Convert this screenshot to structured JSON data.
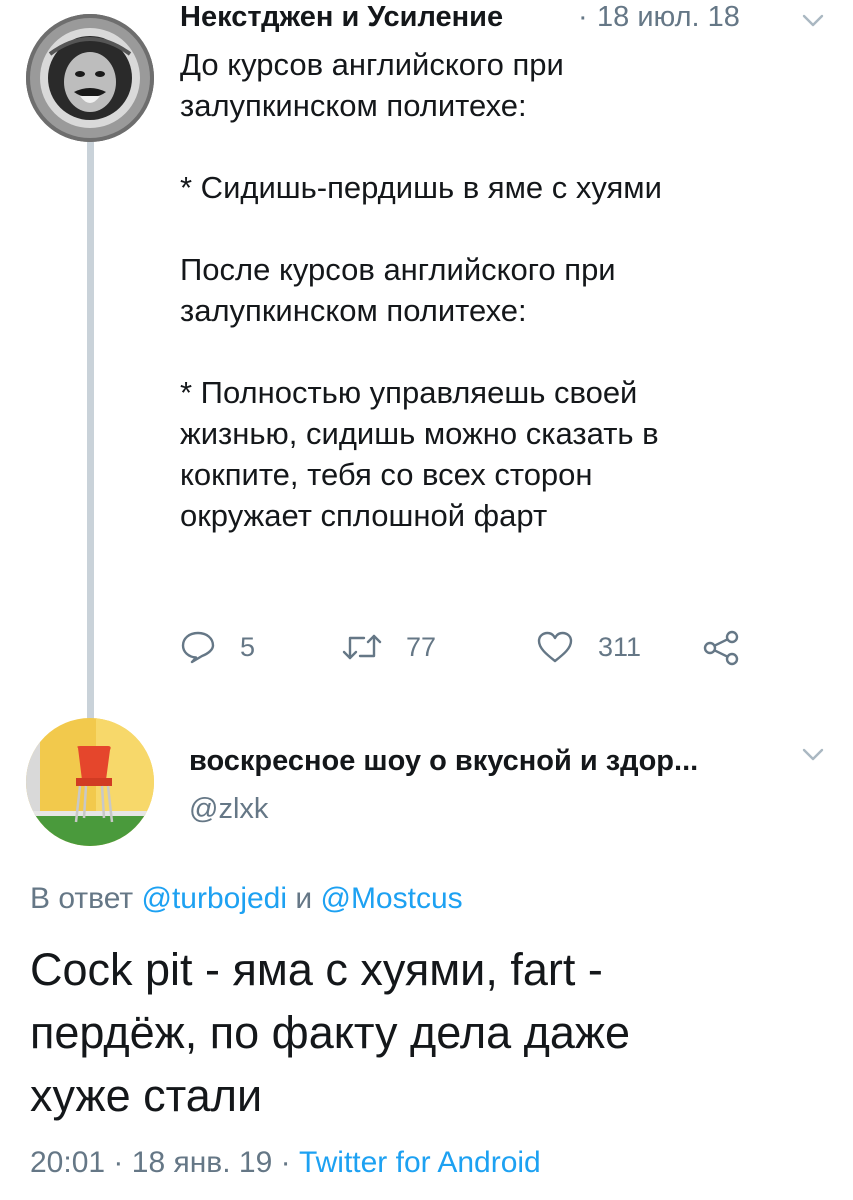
{
  "tweet1": {
    "author_name": "Некстджен и Усиление",
    "separator": "·",
    "date": "18 июл. 18",
    "body": [
      "До курсов английского при",
      "залупкинском политехе:",
      "",
      "* Сидишь-пердишь в яме с хуями",
      "",
      "После курсов английского при",
      "залупкинском политехе:",
      "",
      "* Полностью управляешь своей",
      "жизнью, сидишь можно сказать в",
      "кокпите, тебя со всех сторон",
      "окружает сплошной фарт"
    ],
    "actions": {
      "reply_count": "5",
      "retweet_count": "77",
      "like_count": "311"
    },
    "icons": [
      "reply-icon",
      "retweet-icon",
      "like-icon",
      "share-icon",
      "chevron-down-icon"
    ]
  },
  "tweet2": {
    "author_name": "воскресное шоу о вкусной и здор...",
    "handle": "@zlxk",
    "reply_prefix": "В ответ",
    "reply_user1": "@turbojedi",
    "reply_and": "и",
    "reply_user2": "@Mostcus",
    "body": [
      "Cock pit - яма с хуями, fart -",
      "пердёж, по факту дела даже",
      "хуже стали"
    ],
    "time": "20:01",
    "separator": "·",
    "date": "18 янв. 19",
    "source": "Twitter for Android"
  },
  "colors": {
    "text": "#14171a",
    "secondary": "#657786",
    "link": "#1da1f2",
    "thread_line": "#c9d2d9"
  }
}
